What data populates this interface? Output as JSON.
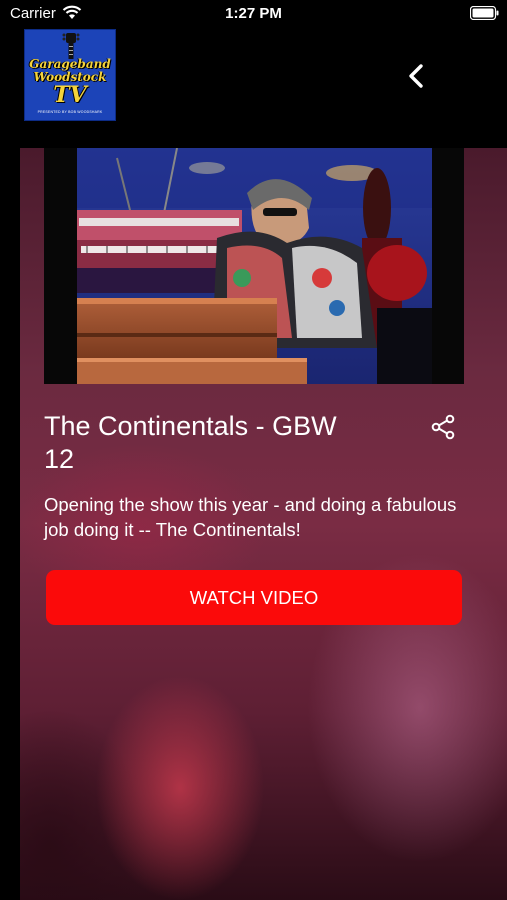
{
  "status_bar": {
    "carrier": "Carrier",
    "time": "1:27 PM"
  },
  "header": {
    "logo": {
      "line1": "Garageband",
      "line2": "Woodstock",
      "line3": "TV",
      "subtitle": "PRESENTED BY BOB WOODSHARK"
    },
    "back_icon": "chevron-left-icon"
  },
  "video": {
    "title": "The Continentals - GBW 12",
    "description": "Opening the show this year - and doing a fabulous job doing it -- The Continentals!",
    "watch_button_label": "WATCH VIDEO",
    "share_icon": "share-icon"
  },
  "colors": {
    "accent": "#fb0a0a",
    "logo_background": "#1c44b8",
    "logo_text": "#f5d33b",
    "background": "#000000"
  }
}
